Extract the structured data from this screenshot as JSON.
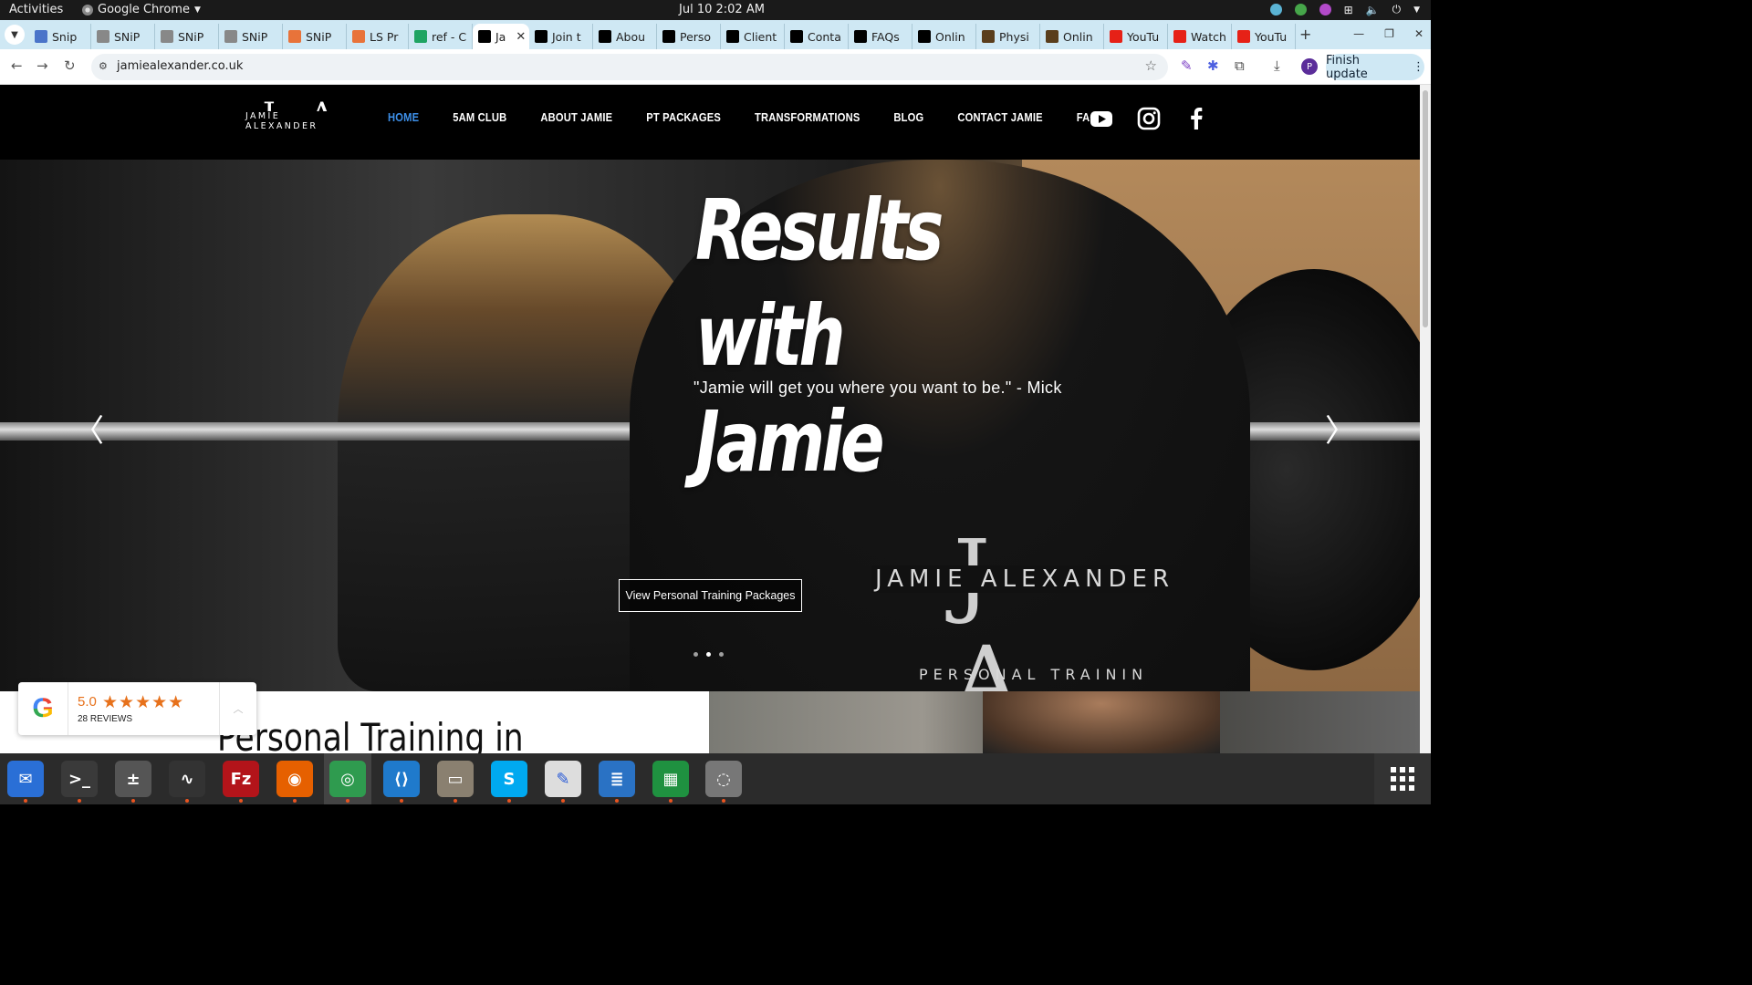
{
  "os": {
    "activities": "Activities",
    "app_name": "Google Chrome",
    "clock": "Jul 10  2:02 AM"
  },
  "browser": {
    "tabs": [
      {
        "label": "Snip",
        "color": "#4a74c9"
      },
      {
        "label": "SNiP",
        "color": "#888888"
      },
      {
        "label": "SNiP",
        "color": "#888888"
      },
      {
        "label": "SNiP",
        "color": "#888888"
      },
      {
        "label": "SNiP",
        "color": "#e8733a"
      },
      {
        "label": "LS Pr",
        "color": "#e8733a"
      },
      {
        "label": "ref - C",
        "color": "#1fa463"
      },
      {
        "label": "Ja",
        "color": "#000000",
        "active": true
      },
      {
        "label": "Join t",
        "color": "#000000"
      },
      {
        "label": "Abou",
        "color": "#000000"
      },
      {
        "label": "Perso",
        "color": "#000000"
      },
      {
        "label": "Client",
        "color": "#000000"
      },
      {
        "label": "Conta",
        "color": "#000000"
      },
      {
        "label": "FAQs",
        "color": "#000000"
      },
      {
        "label": "Onlin",
        "color": "#000000"
      },
      {
        "label": "Physi",
        "color": "#5a3e1c"
      },
      {
        "label": "Onlin",
        "color": "#5a3e1c"
      },
      {
        "label": "YouTu",
        "color": "#e62117"
      },
      {
        "label": "Watch",
        "color": "#e62117"
      },
      {
        "label": "YouTu",
        "color": "#e62117"
      }
    ],
    "url": "jamiealexander.co.uk",
    "finish_update": "Finish update",
    "profile_initial": "P"
  },
  "site": {
    "logo_monogram": "J A",
    "logo_wordmark": "JAMIE ALEXANDER",
    "nav": [
      "HOME",
      "5AM CLUB",
      "ABOUT JAMIE",
      "PT PACKAGES",
      "TRANSFORMATIONS",
      "BLOG",
      "CONTACT JAMIE",
      "FAQs"
    ],
    "nav_active_color": "#3d8fe8",
    "social": [
      "youtube-icon",
      "instagram-icon",
      "facebook-icon"
    ],
    "hero": {
      "headline_line1": "Results with",
      "headline_line2": "Jamie",
      "quote": "\"Jamie will get you where you want to be.\" - Mick",
      "cta": "View Personal Training Packages",
      "slide_count": 3,
      "active_slide": 1,
      "shirt_monogram": "J A",
      "shirt_name": "JAMIE ALEXANDER",
      "shirt_sub": "PERSONAL TRAININ"
    },
    "section_title": "Personal Training in",
    "google_widget": {
      "score": "5.0",
      "stars": "★★★★★",
      "reviews": "28 REVIEWS",
      "star_color": "#e7711b"
    }
  },
  "dock": [
    "thunderbird-icon",
    "terminal-icon",
    "calculator-icon",
    "system-monitor-icon",
    "filezilla-icon",
    "firefox-icon",
    "chrome-icon",
    "vscode-icon",
    "files-icon",
    "skype-icon",
    "text-editor-icon",
    "writer-icon",
    "calc-icon",
    "disk-icon"
  ]
}
